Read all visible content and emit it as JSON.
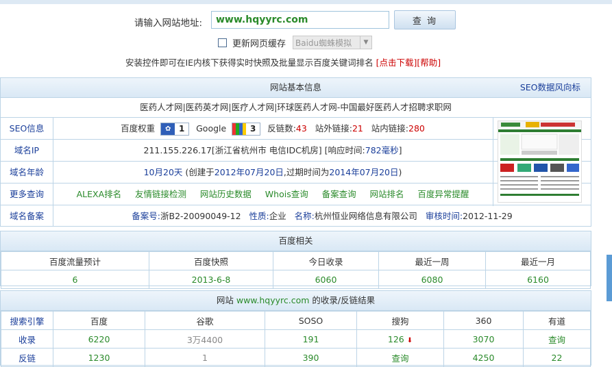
{
  "form": {
    "url_label": "请输入网站地址:",
    "url_value": "www.hqyyrc.com",
    "query_button": "查 询",
    "refresh_label": "更新网页缓存",
    "select_value": "Baidu蜘蛛模拟",
    "install_text": "安装控件即可在IE内核下获得实时快照及批量显示百度关键词排名",
    "download_link": "[点击下载]",
    "help_link": "[帮助]"
  },
  "basic": {
    "header": "网站基本信息",
    "seo_link": "SEO数据风向标",
    "site_title": "医药人才网|医药英才网|医疗人才网|环球医药人才网-中国最好医药人才招聘求职网",
    "seo_label": "SEO信息",
    "baidu_weight_label": "百度权重",
    "baidu_weight": "1",
    "google_label": "Google",
    "google_pr": "3",
    "backlinks_label": "反链数:",
    "backlinks": "43",
    "outlinks_label": "站外链接:",
    "outlinks": "21",
    "inlinks_label": "站内链接:",
    "inlinks": "280",
    "ip_label": "域名IP",
    "ip_text": "211.155.226.17[浙江省杭州市 电信IDC机房]",
    "response_label": "[响应时间:",
    "response_value": "782毫秒",
    "response_end": "]",
    "age_label": "域名年龄",
    "age_value": "10月20天",
    "age_created_label": "(创建于",
    "age_created": "2012年07月20日",
    "age_expire_label": ",过期时间为",
    "age_expire": "2014年07月20日",
    "age_end": ")",
    "more_label": "更多查询",
    "more_links": [
      "ALEXA排名",
      "友情链接检测",
      "网站历史数据",
      "Whois查询",
      "备案查询",
      "网站排名",
      "百度异常提醒"
    ],
    "icp_label": "域名备案",
    "icp_no_label": "备案号:",
    "icp_no": "浙B2-20090049-12",
    "nature_label": "性质:",
    "nature": "企业",
    "name_label": "名称:",
    "name": "杭州恒业网络信息有限公司",
    "audit_label": "审核时间:",
    "audit": "2012-11-29"
  },
  "baidu": {
    "header": "百度相关",
    "columns": [
      "百度流量预计",
      "百度快照",
      "今日收录",
      "最近一周",
      "最近一月"
    ],
    "values": [
      "6",
      "2013-6-8",
      "6060",
      "6080",
      "6160"
    ]
  },
  "index": {
    "header_prefix": "网站",
    "header_domain": "www.hqyyrc.com",
    "header_suffix": "的收录/反链结果",
    "columns": [
      "搜索引擎",
      "百度",
      "谷歌",
      "SOSO",
      "搜狗",
      "360",
      "有道"
    ],
    "row1_label": "收录",
    "row1": [
      "6220",
      "3万4400",
      "191",
      "126",
      "3070",
      "查询"
    ],
    "row2_label": "反链",
    "row2": [
      "1230",
      "1",
      "390",
      "查询",
      "4250",
      "22"
    ]
  },
  "colors": {
    "accent_blue": "#1a3e9a",
    "value_green": "#2a8a2a",
    "value_red": "#cc0000",
    "header_bg": "#d9e8f5",
    "border": "#bcd4e6"
  }
}
